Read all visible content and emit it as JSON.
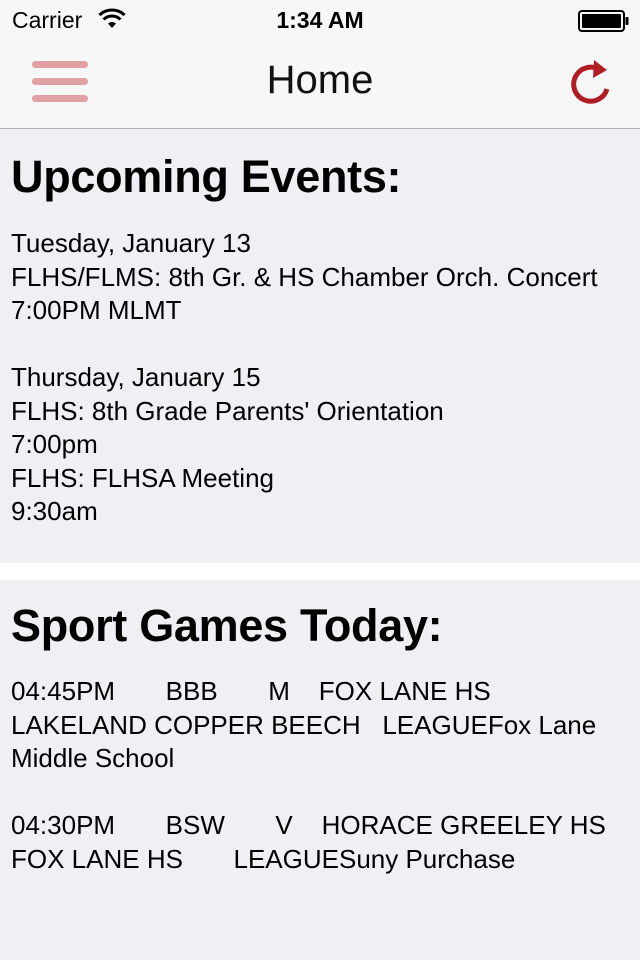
{
  "status_bar": {
    "carrier": "Carrier",
    "time": "1:34 AM",
    "wifi_icon": "wifi-icon",
    "battery_icon": "battery-full-icon"
  },
  "nav": {
    "title": "Home",
    "menu_icon": "hamburger-menu-icon",
    "refresh_icon": "refresh-icon",
    "accent_color": "#b01e24",
    "menu_color": "#e0a0a4"
  },
  "events": {
    "heading": "Upcoming Events:",
    "body": "Tuesday, January 13\nFLHS/FLMS: 8th Gr. & HS Chamber Orch. Concert\n7:00PM MLMT\n\nThursday, January 15\nFLHS: 8th Grade Parents' Orientation\n7:00pm\nFLHS: FLHSA Meeting\n9:30am"
  },
  "sports": {
    "heading": "Sport Games Today:",
    "body": "04:45PM       BBB       M    FOX LANE HS   LAKELAND COPPER BEECH   LEAGUEFox Lane Middle School\n\n04:30PM       BSW       V    HORACE GREELEY HS   FOX LANE HS       LEAGUESuny Purchase"
  }
}
